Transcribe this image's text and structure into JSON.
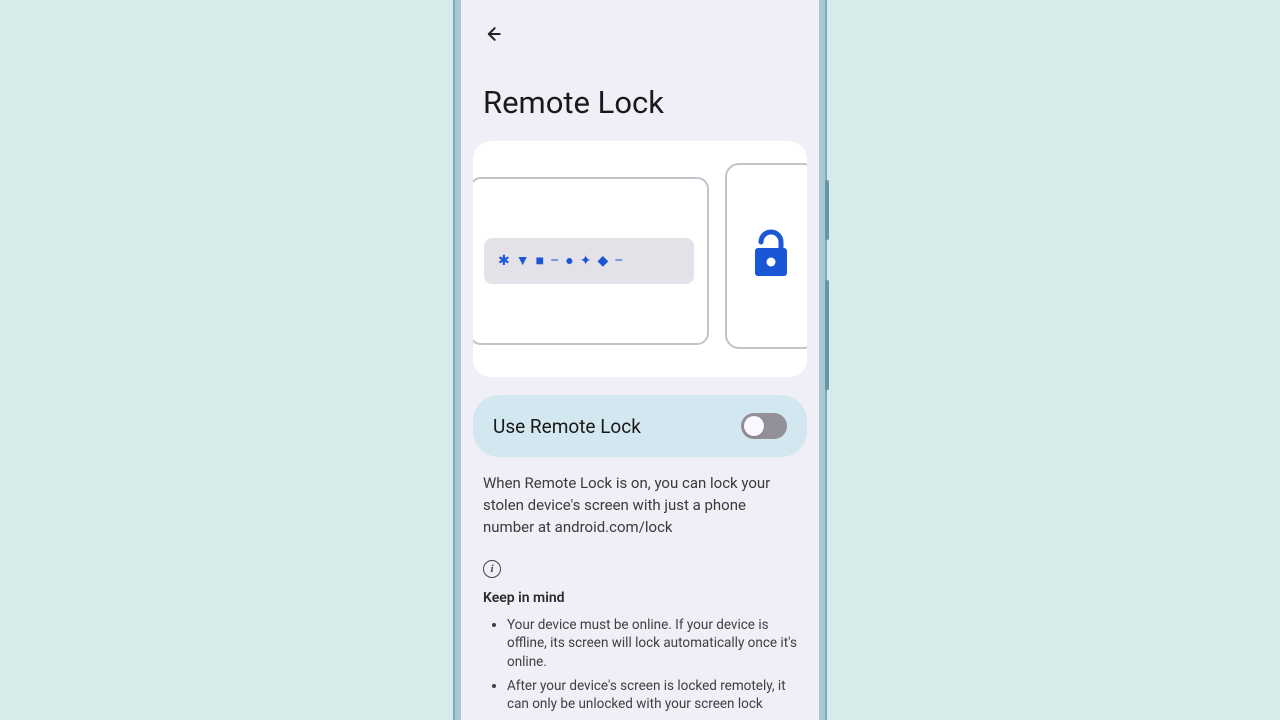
{
  "header": {
    "title": "Remote Lock"
  },
  "hero": {
    "lock_state": "unlocked"
  },
  "toggle": {
    "label": "Use Remote Lock",
    "enabled": false
  },
  "description": "When Remote Lock is on, you can lock your stolen device's screen with just a phone number at android.com/lock",
  "keep": {
    "heading": "Keep in mind",
    "items": [
      "Your device must be online. If your device is offline, its screen will lock automatically once it's online.",
      "After your device's screen is locked remotely, it can only be unlocked with your screen lock"
    ]
  }
}
